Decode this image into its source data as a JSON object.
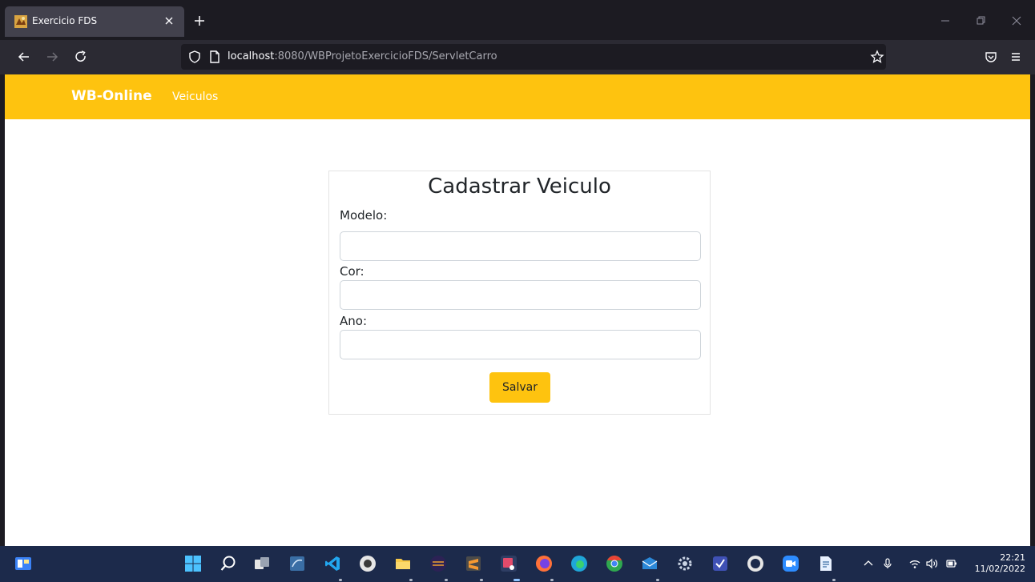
{
  "browser": {
    "tab": {
      "title": "Exercicio FDS"
    },
    "url": {
      "host": "localhost",
      "rest": ":8080/WBProjetoExercicioFDS/ServletCarro"
    }
  },
  "site": {
    "brand": "WB-Online",
    "nav": {
      "veiculos": "Veiculos"
    },
    "accent_color": "#fec30f"
  },
  "form": {
    "title": "Cadastrar Veiculo",
    "fields": [
      {
        "label": "Modelo:",
        "value": ""
      },
      {
        "label": "Cor:",
        "value": ""
      },
      {
        "label": "Ano:",
        "value": ""
      }
    ],
    "submit_label": "Salvar"
  },
  "taskbar": {
    "time": "22:21",
    "date": "11/02/2022",
    "apps": [
      "start-icon",
      "search-icon",
      "task-view-icon",
      "mysql-workbench-icon",
      "vscode-icon",
      "github-desktop-icon",
      "file-explorer-icon",
      "eclipse-icon",
      "sublime-icon",
      "snipping-tool-icon",
      "firefox-icon",
      "edge-icon",
      "chrome-icon",
      "mail-icon",
      "settings-icon",
      "app-icon",
      "github-icon",
      "zoom-icon",
      "notepad-icon"
    ]
  }
}
